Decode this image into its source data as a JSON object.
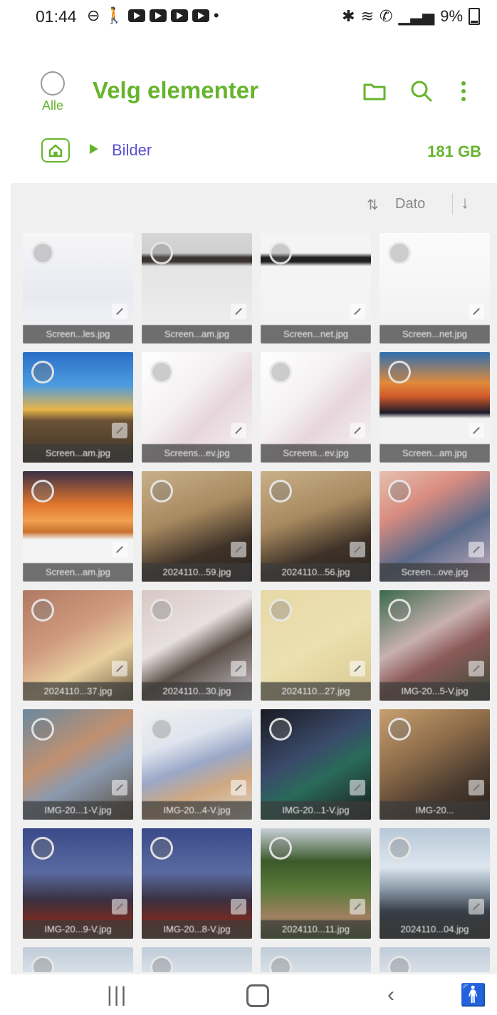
{
  "status_bar": {
    "time": "01:44",
    "battery": "9%"
  },
  "header": {
    "select_all_label": "Alle",
    "title": "Velg elementer",
    "icons": [
      "folder-icon",
      "search-icon",
      "more-vert-icon"
    ]
  },
  "breadcrumb": {
    "folder": "Bilder",
    "storage": "181 GB"
  },
  "sort": {
    "label": "Dato"
  },
  "grid": {
    "items": [
      {
        "caption": "Screen...les.jpg",
        "bg": "linear-gradient(180deg,#f6f6f8 0%,#e8eaf0 55%,#f4f4f6 100%)"
      },
      {
        "caption": "Screen...am.jpg",
        "bg": "linear-gradient(180deg,#d6d6d6 0%,#cfcfcf 18%,#3a3230 22%,#3a3230 26%,#e4e4e4 30%,#f0f0f0 100%)"
      },
      {
        "caption": "Screen...net.jpg",
        "bg": "linear-gradient(180deg,#f4f4f4 0%,#f4f4f4 18%,#202020 22%,#202020 26%,#f4f4f4 30%,#f2f2f2 100%)"
      },
      {
        "caption": "Screen...net.jpg",
        "bg": "linear-gradient(180deg,#fbfbfb 0%,#f0f0f0 100%)"
      },
      {
        "caption": "Screen...am.jpg",
        "bg": "linear-gradient(180deg,#2a6fc7 0%,#4c9be0 30%,#e8b548 52%,#6b5236 62%,#3b3228 100%)"
      },
      {
        "caption": "Screens...ev.jpg",
        "bg": "linear-gradient(135deg,#ffffff 0%,#f4f0f2 40%,#e7d6dc 60%,#f6f6f6 100%)"
      },
      {
        "caption": "Screens...ev.jpg",
        "bg": "linear-gradient(135deg,#ffffff 0%,#f4f0f2 40%,#e7d6dc 60%,#f6f6f6 100%)"
      },
      {
        "caption": "Screen...am.jpg",
        "bg": "linear-gradient(180deg,#2f6fb0 0%,#e08a3a 28%,#d25a2a 40%,#1a1a2a 55%,#f2f2f2 60%,#f2f2f2 100%)"
      },
      {
        "caption": "Screen...am.jpg",
        "bg": "linear-gradient(180deg,#3b3048 0%,#e0752c 30%,#f0a050 45%,#c8702c 55%,#f4f4f4 62%,#f4f4f4 100%)"
      },
      {
        "caption": "2024110...59.jpg",
        "bg": "linear-gradient(160deg,#c8b08a 0%,#a98a60 40%,#3e3228 70%,#2a2420 100%)"
      },
      {
        "caption": "2024110...56.jpg",
        "bg": "linear-gradient(160deg,#c8b08a 0%,#a98a60 40%,#3e3228 70%,#2a2420 100%)"
      },
      {
        "caption": "Screen...ove.jpg",
        "bg": "linear-gradient(150deg,#e6c0b0 0%,#d98c80 30%,#5a6a8a 60%,#c8b0c0 100%)"
      },
      {
        "caption": "2024110...37.jpg",
        "bg": "linear-gradient(150deg,#b07a62 0%,#d09a80 40%,#e8d0a0 65%,#6a5a40 100%)"
      },
      {
        "caption": "2024110...30.jpg",
        "bg": "linear-gradient(150deg,#d8c8c4 0%,#e8e0e0 40%,#5a5048 60%,#c8c0c8 100%)"
      },
      {
        "caption": "2024110...27.jpg",
        "bg": "linear-gradient(150deg,#e8d8a8 0%,#ece0b0 50%,#d8c890 100%)"
      },
      {
        "caption": "IMG-20...5-V.jpg",
        "bg": "linear-gradient(150deg,#3a6a4a 0%,#c8b0b0 40%,#8a5a58 60%,#3a4a3a 100%)"
      },
      {
        "caption": "IMG-20...1-V.jpg",
        "bg": "linear-gradient(150deg,#6a8aa0 0%,#c09070 40%,#8a9ab0 60%,#5a4a3a 100%)"
      },
      {
        "caption": "IMG-20...4-V.jpg",
        "bg": "linear-gradient(160deg,#f0f0f0 0%,#dfe4ee 30%,#9aa8c8 50%,#d0a880 70%,#e0d8d0 100%)"
      },
      {
        "caption": "IMG-20...1-V.jpg",
        "bg": "linear-gradient(150deg,#1a1a22 0%,#3a4a6a 40%,#2a6a5a 60%,#1a1a1a 100%)"
      },
      {
        "caption": "IMG-20...",
        "bg": "linear-gradient(150deg,#c8a070 0%,#8a6a48 40%,#4a3a30 70%,#2a2018 100%)"
      },
      {
        "caption": "IMG-20...9-V.jpg",
        "bg": "linear-gradient(180deg,#3a4a8a 0%,#5a6aa0 40%,#3a3040 65%,#7a2a20 85%,#5a4030 100%)"
      },
      {
        "caption": "IMG-20...8-V.jpg",
        "bg": "linear-gradient(180deg,#3a4a8a 0%,#5a6aa0 40%,#3a3040 65%,#7a2a20 85%,#5a4030 100%)"
      },
      {
        "caption": "2024110...11.jpg",
        "bg": "linear-gradient(180deg,#c8d0d8 0%,#3a5a2a 30%,#5a7a3a 55%,#a08060 80%,#4a6a2a 100%)"
      },
      {
        "caption": "2024110...04.jpg",
        "bg": "linear-gradient(180deg,#b8c8d8 0%,#dce6ee 35%,#8a9aa8 55%,#3a4048 75%,#2a2e30 100%)"
      },
      {
        "caption": "",
        "bg": "linear-gradient(180deg,#c0ccd8 0%,#d8e0e8 100%)"
      },
      {
        "caption": "",
        "bg": "linear-gradient(180deg,#c0ccd8 0%,#d8e0e8 100%)"
      },
      {
        "caption": "",
        "bg": "linear-gradient(180deg,#c0ccd8 0%,#d8e0e8 100%)"
      },
      {
        "caption": "",
        "bg": "linear-gradient(180deg,#c0ccd8 0%,#d8e0e8 100%)"
      }
    ]
  },
  "colors": {
    "accent": "#66b42d",
    "path": "#5a4fcf"
  }
}
